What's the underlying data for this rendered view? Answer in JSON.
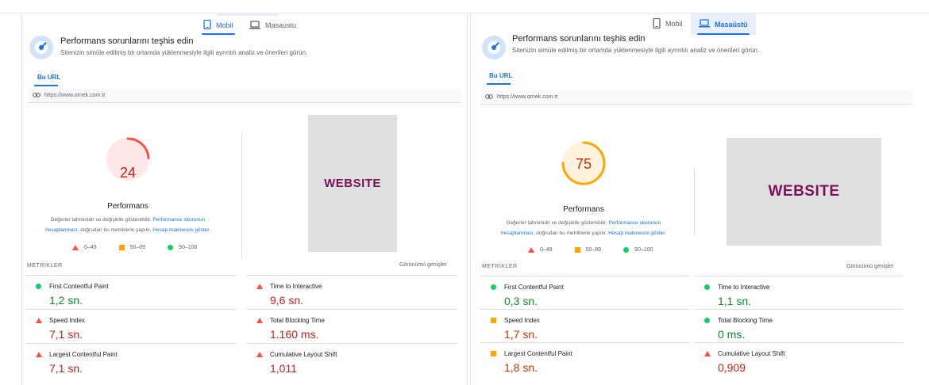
{
  "colors": {
    "fail": "#ff4e42",
    "average": "#ffa400",
    "pass": "#0cce6b",
    "accent": "#1a73e8",
    "website_text": "#7b1259"
  },
  "panels": [
    {
      "device_tabs": [
        {
          "label": "Mobil",
          "icon": "phone-icon",
          "active": true
        },
        {
          "label": "Masaustu",
          "icon": "laptop-icon",
          "active": false
        }
      ],
      "title": "Performans sorunlarını teşhis edin",
      "subtitle": "Sitenizin simüle edilmiş bir ortamda yüklenmesiyle ilgili ayrıntılı analiz ve önerileri görün.",
      "url_tab": "Bu URL",
      "url": "https://www.ornek.com.tr",
      "score": "24",
      "score_value": 24,
      "score_label": "Performans",
      "note_1": "Değerler tahminidir ve değişiklik gösterebilir.",
      "note_link_1": "Performance skorunun",
      "note_link_1b": "hesaplanması",
      "note_2": ", doğrudan bu metriklerle yapılır.",
      "note_link_2": "Hesap makinesini göster.",
      "legend": [
        "0–49",
        "50–89",
        "90–100"
      ],
      "thumbnail_text": "WEBSITE",
      "metrics_heading": "METRİKLER",
      "expand_label": "Görünümü genişlet",
      "metrics": [
        {
          "name": "First Contentful Paint",
          "value": "1,2 sn.",
          "status": "pass"
        },
        {
          "name": "Time to Interactive",
          "value": "9,6 sn.",
          "status": "fail"
        },
        {
          "name": "Speed Index",
          "value": "7,1 sn.",
          "status": "fail"
        },
        {
          "name": "Total Blocking Time",
          "value": "1.160 ms.",
          "status": "fail"
        },
        {
          "name": "Largest Contentful Paint",
          "value": "7,1 sn.",
          "status": "fail"
        },
        {
          "name": "Cumulative Layout Shift",
          "value": "1,011",
          "status": "fail"
        }
      ]
    },
    {
      "device_tabs": [
        {
          "label": "Mobil",
          "icon": "phone-icon",
          "active": false
        },
        {
          "label": "Masaüstü",
          "icon": "laptop-icon",
          "active": true
        }
      ],
      "title": "Performans sorunlarını teşhis edin",
      "subtitle": "Sitenizin simüle edilmiş bir ortamda yüklenmesiyle ilgili ayrıntılı analiz ve önerileri görün.",
      "url_tab": "Bu URL",
      "url": "https://www.ornek.com.tr",
      "score": "75",
      "score_value": 75,
      "score_label": "Performans",
      "note_1": "Değerler tahminidir ve değişiklik gösterebilir.",
      "note_link_1": "Performance skorunun",
      "note_link_1b": "hesaplanması",
      "note_2": ", doğrudan bu metriklerle yapılır.",
      "note_link_2": "Hesap makinesini göster.",
      "legend": [
        "0–49",
        "50–89",
        "90–100"
      ],
      "thumbnail_text": "WEBSITE",
      "metrics_heading": "METRİKLER",
      "expand_label": "Görünümü genişlet",
      "metrics": [
        {
          "name": "First Contentful Paint",
          "value": "0,3 sn.",
          "status": "pass"
        },
        {
          "name": "Time to Interactive",
          "value": "1,1 sn.",
          "status": "pass"
        },
        {
          "name": "Speed Index",
          "value": "1,7 sn.",
          "status": "average"
        },
        {
          "name": "Total Blocking Time",
          "value": "0 ms.",
          "status": "pass"
        },
        {
          "name": "Largest Contentful Paint",
          "value": "1,8 sn.",
          "status": "average"
        },
        {
          "name": "Cumulative Layout Shift",
          "value": "0,909",
          "status": "fail"
        }
      ]
    }
  ]
}
